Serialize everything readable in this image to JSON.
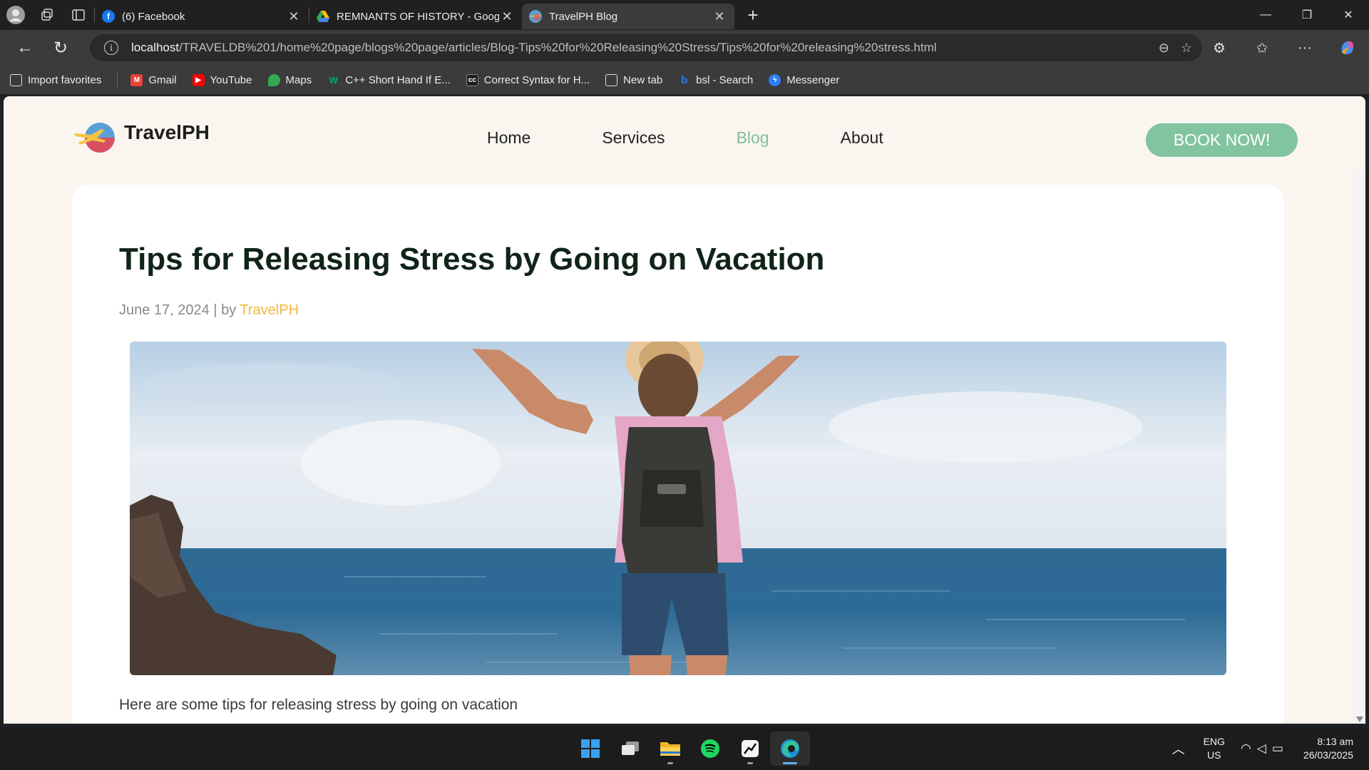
{
  "browser": {
    "tabs": [
      {
        "label": "(6) Facebook",
        "icon": "facebook-icon",
        "active": false
      },
      {
        "label": "REMNANTS OF HISTORY - Google",
        "icon": "google-drive-icon",
        "active": false
      },
      {
        "label": "TravelPH Blog",
        "icon": "travelph-icon",
        "active": true
      }
    ],
    "url_host": "localhost",
    "url_path": "/TRAVELDB%201/home%20page/blogs%20page/articles/Blog-Tips%20for%20Releasing%20Stress/Tips%20for%20releasing%20stress.html",
    "bookmarks": [
      {
        "label": "Import favorites",
        "icon": "import-icon"
      },
      {
        "label": "Gmail",
        "icon": "gmail-icon",
        "color": "#ea4335"
      },
      {
        "label": "YouTube",
        "icon": "youtube-icon",
        "color": "#ff0000"
      },
      {
        "label": "Maps",
        "icon": "maps-icon",
        "color": "#34a853"
      },
      {
        "label": "C++ Short Hand If E...",
        "icon": "w3schools-icon",
        "color": "#04aa6d"
      },
      {
        "label": "Correct Syntax for H...",
        "icon": "cc-icon",
        "color": "#4a3a2a"
      },
      {
        "label": "New tab",
        "icon": "newtab-icon"
      },
      {
        "label": "bsl - Search",
        "icon": "bing-icon",
        "color": "#2b7de9"
      },
      {
        "label": "Messenger",
        "icon": "messenger-icon",
        "color": "#2f7cf6"
      }
    ]
  },
  "site": {
    "brand": "TravelPH",
    "nav": [
      "Home",
      "Services",
      "Blog",
      "About"
    ],
    "active_nav": "Blog",
    "cta": "BOOK NOW!",
    "accent_color": "#82c4a0",
    "author_color": "#f2b93b"
  },
  "article": {
    "title": "Tips for Releasing Stress by Going on Vacation",
    "date": "June 17, 2024",
    "by": "| by",
    "author": "TravelPH",
    "intro": "Here are some tips for releasing stress by going on vacation"
  },
  "taskbar": {
    "apps": [
      "windows-start-icon",
      "task-view-icon",
      "file-explorer-icon",
      "spotify-icon",
      "stocks-app-icon",
      "edge-icon"
    ],
    "lang_line1": "ENG",
    "lang_line2": "US",
    "time": "8:13 am",
    "date": "26/03/2025"
  }
}
